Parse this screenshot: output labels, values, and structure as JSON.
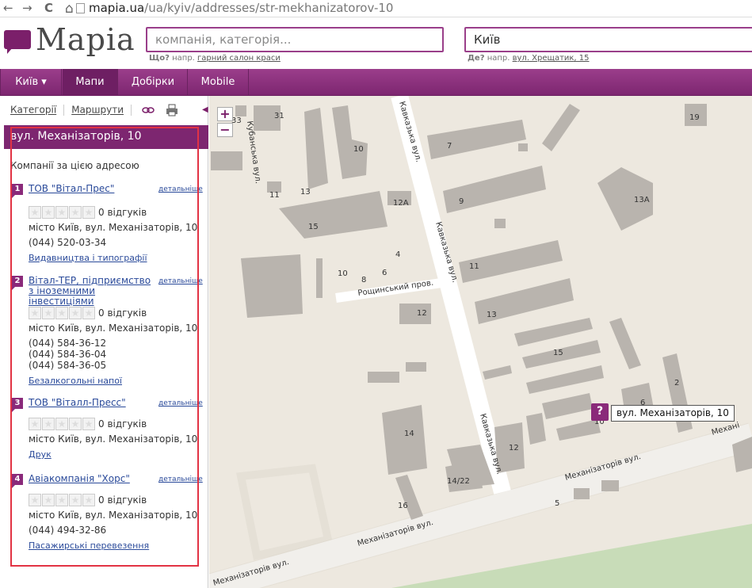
{
  "browser": {
    "url_host": "mapia.ua",
    "url_path": "/ua/kyiv/addresses/str-mekhanizatorov-10",
    "back_icon": "←",
    "forward_icon": "→",
    "reload_icon": "C",
    "home_icon": "⌂"
  },
  "header": {
    "logo_text": "Mapia",
    "what_placeholder": "компанія, категорія...",
    "where_value": "Київ",
    "what_hint_label": "Що?",
    "what_hint_prefix": "напр.",
    "what_hint_example": "гарний салон краси",
    "where_hint_label": "Де?",
    "where_hint_prefix": "напр.",
    "where_hint_example": "вул. Хрещатик, 15"
  },
  "menu": {
    "city": "Київ ▾",
    "maps": "Мапи",
    "collections": "Добірки",
    "mobile": "Mobile"
  },
  "sidebar": {
    "tab_categories": "Категорії",
    "tab_routes": "Маршрути",
    "collapse_icon": "◀",
    "address_title": "вул. Механізаторів, 10",
    "section_title": "Компанії за цією адресою",
    "companies": [
      {
        "num": "1",
        "name": "ТОВ \"Вітал-Прес\"",
        "details": "детальніше",
        "reviews": "0 відгуків",
        "address": "місто Київ, вул. Механізаторів, 10",
        "phones": [
          "(044) 520-03-34"
        ],
        "category": "Видавництва і типографії"
      },
      {
        "num": "2",
        "name": "Вітал-ТЕР, підприємство з іноземними інвестиціями",
        "details": "детальніше",
        "reviews": "0 відгуків",
        "address": "місто Київ, вул. Механізаторів, 10",
        "phones": [
          "(044) 584-36-12",
          "(044) 584-36-04",
          "(044) 584-36-05"
        ],
        "category": "Безалкогольні напої"
      },
      {
        "num": "3",
        "name": "ТОВ \"Віталл-Пресс\"",
        "details": "детальніше",
        "reviews": "0 відгуків",
        "address": "місто Київ, вул. Механізаторів, 10",
        "phones": [],
        "category": "Друк"
      },
      {
        "num": "4",
        "name": "Авіакомпанія \"Хорс\"",
        "details": "детальніше",
        "reviews": "0 відгуків",
        "address": "місто Київ, вул. Механізаторів, 10",
        "phones": [
          "(044) 494-32-86"
        ],
        "category": "Пасажирські перевезення"
      }
    ]
  },
  "map": {
    "zoom_in": "+",
    "zoom_out": "−",
    "marker_icon": "?",
    "marker_label": "вул. Механізаторів, 10",
    "streets": {
      "kavkazka_top": "Кавказька вул.",
      "kavkazka_mid": "Кавказька вул.",
      "kavkazka_bottom": "Кавказька вул.",
      "kubanska": "Кубанська вул.",
      "roshchynskyi": "Рощинський пров.",
      "mekh_right": "Механізаторів вул.",
      "mekh_mid": "Механізаторів вул.",
      "mekh_left": "Механізаторів вул.",
      "mekh_far": "Механізаторів вул.",
      "mekh_edge": "Механі"
    },
    "house_numbers": [
      "31",
      "33",
      "10",
      "7",
      "19",
      "11",
      "13",
      "12А",
      "9",
      "13А",
      "15",
      "4",
      "11",
      "10",
      "8",
      "6",
      "12",
      "13",
      "15",
      "2",
      "6",
      "10",
      "14",
      "12",
      "14/22",
      "16",
      "5"
    ]
  }
}
